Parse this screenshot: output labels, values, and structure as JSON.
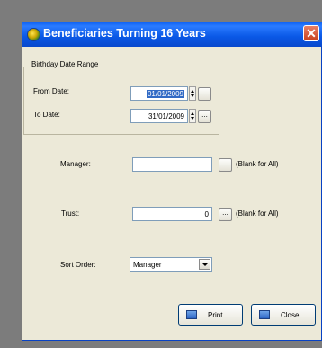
{
  "window": {
    "title": "Beneficiaries Turning 16 Years",
    "close_glyph": "✕"
  },
  "birthday_group": {
    "label": "Birthday Date Range",
    "from_label": "From Date:",
    "from_value": "01/01/2009",
    "to_label": "To Date:",
    "to_value": "31/01/2009"
  },
  "manager": {
    "label": "Manager:",
    "value": "",
    "hint": "(Blank for All)"
  },
  "trust": {
    "label": "Trust:",
    "value": "0",
    "hint": "(Blank for All)"
  },
  "sort": {
    "label": "Sort Order:",
    "selected": "Manager"
  },
  "lookup_glyph": "...",
  "buttons": {
    "print": "Print",
    "close": "Close"
  }
}
